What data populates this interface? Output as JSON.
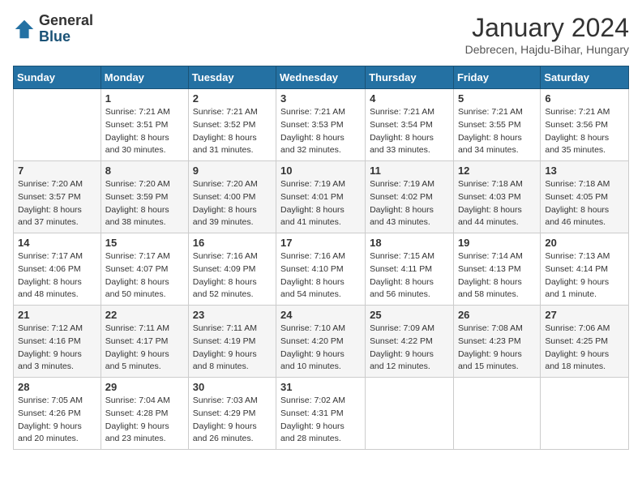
{
  "header": {
    "logo_general": "General",
    "logo_blue": "Blue",
    "month_title": "January 2024",
    "location": "Debrecen, Hajdu-Bihar, Hungary"
  },
  "weekdays": [
    "Sunday",
    "Monday",
    "Tuesday",
    "Wednesday",
    "Thursday",
    "Friday",
    "Saturday"
  ],
  "weeks": [
    [
      {
        "day": "",
        "info": ""
      },
      {
        "day": "1",
        "info": "Sunrise: 7:21 AM\nSunset: 3:51 PM\nDaylight: 8 hours\nand 30 minutes."
      },
      {
        "day": "2",
        "info": "Sunrise: 7:21 AM\nSunset: 3:52 PM\nDaylight: 8 hours\nand 31 minutes."
      },
      {
        "day": "3",
        "info": "Sunrise: 7:21 AM\nSunset: 3:53 PM\nDaylight: 8 hours\nand 32 minutes."
      },
      {
        "day": "4",
        "info": "Sunrise: 7:21 AM\nSunset: 3:54 PM\nDaylight: 8 hours\nand 33 minutes."
      },
      {
        "day": "5",
        "info": "Sunrise: 7:21 AM\nSunset: 3:55 PM\nDaylight: 8 hours\nand 34 minutes."
      },
      {
        "day": "6",
        "info": "Sunrise: 7:21 AM\nSunset: 3:56 PM\nDaylight: 8 hours\nand 35 minutes."
      }
    ],
    [
      {
        "day": "7",
        "info": "Sunrise: 7:20 AM\nSunset: 3:57 PM\nDaylight: 8 hours\nand 37 minutes."
      },
      {
        "day": "8",
        "info": "Sunrise: 7:20 AM\nSunset: 3:59 PM\nDaylight: 8 hours\nand 38 minutes."
      },
      {
        "day": "9",
        "info": "Sunrise: 7:20 AM\nSunset: 4:00 PM\nDaylight: 8 hours\nand 39 minutes."
      },
      {
        "day": "10",
        "info": "Sunrise: 7:19 AM\nSunset: 4:01 PM\nDaylight: 8 hours\nand 41 minutes."
      },
      {
        "day": "11",
        "info": "Sunrise: 7:19 AM\nSunset: 4:02 PM\nDaylight: 8 hours\nand 43 minutes."
      },
      {
        "day": "12",
        "info": "Sunrise: 7:18 AM\nSunset: 4:03 PM\nDaylight: 8 hours\nand 44 minutes."
      },
      {
        "day": "13",
        "info": "Sunrise: 7:18 AM\nSunset: 4:05 PM\nDaylight: 8 hours\nand 46 minutes."
      }
    ],
    [
      {
        "day": "14",
        "info": "Sunrise: 7:17 AM\nSunset: 4:06 PM\nDaylight: 8 hours\nand 48 minutes."
      },
      {
        "day": "15",
        "info": "Sunrise: 7:17 AM\nSunset: 4:07 PM\nDaylight: 8 hours\nand 50 minutes."
      },
      {
        "day": "16",
        "info": "Sunrise: 7:16 AM\nSunset: 4:09 PM\nDaylight: 8 hours\nand 52 minutes."
      },
      {
        "day": "17",
        "info": "Sunrise: 7:16 AM\nSunset: 4:10 PM\nDaylight: 8 hours\nand 54 minutes."
      },
      {
        "day": "18",
        "info": "Sunrise: 7:15 AM\nSunset: 4:11 PM\nDaylight: 8 hours\nand 56 minutes."
      },
      {
        "day": "19",
        "info": "Sunrise: 7:14 AM\nSunset: 4:13 PM\nDaylight: 8 hours\nand 58 minutes."
      },
      {
        "day": "20",
        "info": "Sunrise: 7:13 AM\nSunset: 4:14 PM\nDaylight: 9 hours\nand 1 minute."
      }
    ],
    [
      {
        "day": "21",
        "info": "Sunrise: 7:12 AM\nSunset: 4:16 PM\nDaylight: 9 hours\nand 3 minutes."
      },
      {
        "day": "22",
        "info": "Sunrise: 7:11 AM\nSunset: 4:17 PM\nDaylight: 9 hours\nand 5 minutes."
      },
      {
        "day": "23",
        "info": "Sunrise: 7:11 AM\nSunset: 4:19 PM\nDaylight: 9 hours\nand 8 minutes."
      },
      {
        "day": "24",
        "info": "Sunrise: 7:10 AM\nSunset: 4:20 PM\nDaylight: 9 hours\nand 10 minutes."
      },
      {
        "day": "25",
        "info": "Sunrise: 7:09 AM\nSunset: 4:22 PM\nDaylight: 9 hours\nand 12 minutes."
      },
      {
        "day": "26",
        "info": "Sunrise: 7:08 AM\nSunset: 4:23 PM\nDaylight: 9 hours\nand 15 minutes."
      },
      {
        "day": "27",
        "info": "Sunrise: 7:06 AM\nSunset: 4:25 PM\nDaylight: 9 hours\nand 18 minutes."
      }
    ],
    [
      {
        "day": "28",
        "info": "Sunrise: 7:05 AM\nSunset: 4:26 PM\nDaylight: 9 hours\nand 20 minutes."
      },
      {
        "day": "29",
        "info": "Sunrise: 7:04 AM\nSunset: 4:28 PM\nDaylight: 9 hours\nand 23 minutes."
      },
      {
        "day": "30",
        "info": "Sunrise: 7:03 AM\nSunset: 4:29 PM\nDaylight: 9 hours\nand 26 minutes."
      },
      {
        "day": "31",
        "info": "Sunrise: 7:02 AM\nSunset: 4:31 PM\nDaylight: 9 hours\nand 28 minutes."
      },
      {
        "day": "",
        "info": ""
      },
      {
        "day": "",
        "info": ""
      },
      {
        "day": "",
        "info": ""
      }
    ]
  ]
}
